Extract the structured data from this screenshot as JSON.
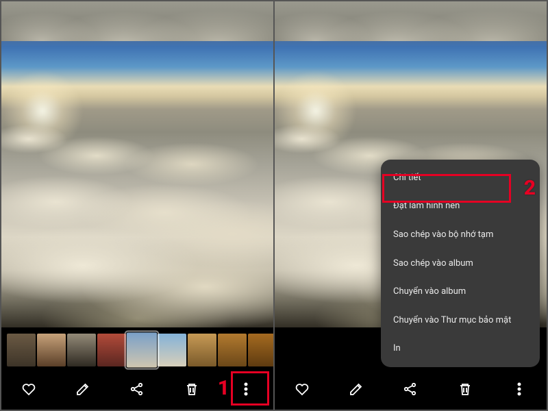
{
  "annotations": {
    "step1": "1",
    "step2": "2",
    "highlight_color": "#e60023"
  },
  "actions": {
    "favorite": "favorite",
    "edit": "edit",
    "share": "share",
    "delete": "delete",
    "more": "more"
  },
  "menu": {
    "items": [
      "Chi tiết",
      "Đặt làm hình nền",
      "Sao chép vào bộ nhớ tạm",
      "Sao chép vào album",
      "Chuyển vào album",
      "Chuyển vào Thư mục bảo mật",
      "In"
    ]
  },
  "thumbnails": {
    "count": 9,
    "selected_index": 4,
    "colors": [
      "linear-gradient(180deg,#6b5a44,#3d3428)",
      "linear-gradient(180deg,#c7a27a,#5a3f28)",
      "linear-gradient(180deg,#938a78,#2f2a22)",
      "linear-gradient(180deg,#b24b3a,#5a2620)",
      "linear-gradient(180deg,#7aa0c8,#cfc6b0)",
      "linear-gradient(180deg,#84b2d8,#d7cfba)",
      "linear-gradient(180deg,#c79a55,#7a5a2a)",
      "linear-gradient(180deg,#b27a2f,#6b4718)",
      "linear-gradient(180deg,#a56a20,#5e3b10)"
    ]
  }
}
